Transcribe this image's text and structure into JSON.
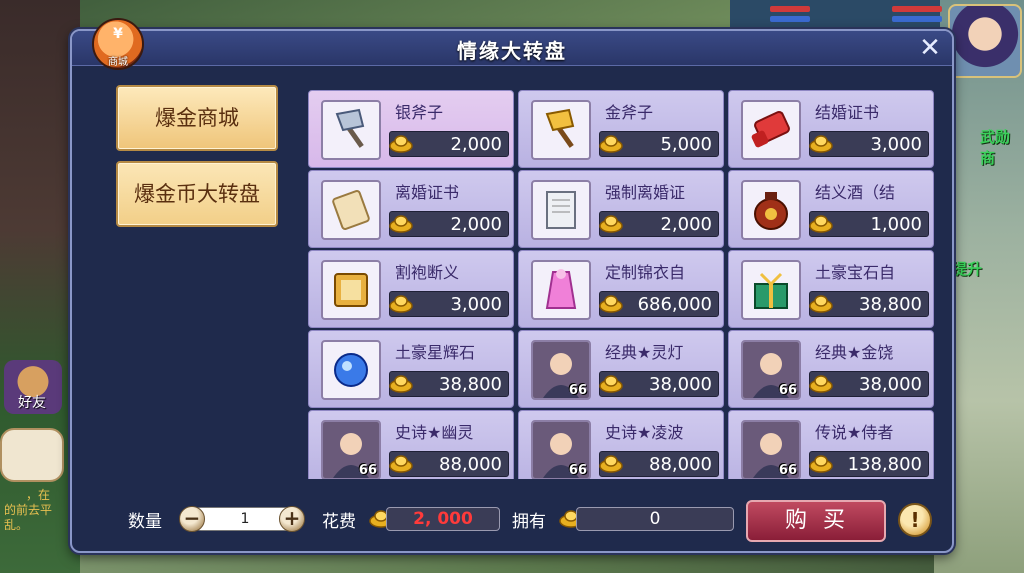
{
  "background": {
    "side_text_1": "武勋商",
    "side_text_2": "提升",
    "friend_label": "好友",
    "chat_text": "的前去平乱。",
    "chat_mid_text": "，在"
  },
  "shop_badge": {
    "symbol": "¥",
    "label": "商城"
  },
  "title": "情缘大转盘",
  "tabs": [
    {
      "label": "爆金商城"
    },
    {
      "label": "爆金币大转盘"
    }
  ],
  "items": [
    {
      "name": "银斧子",
      "price": "2,000",
      "icon": "silver-axe-icon"
    },
    {
      "name": "金斧子",
      "price": "5,000",
      "icon": "gold-axe-icon"
    },
    {
      "name": "结婚证书",
      "price": "3,000",
      "icon": "marriage-scroll-icon"
    },
    {
      "name": "离婚证书",
      "price": "2,000",
      "icon": "divorce-scroll-icon"
    },
    {
      "name": "强制离婚证",
      "price": "2,000",
      "icon": "forced-divorce-paper-icon"
    },
    {
      "name": "结义酒（结",
      "price": "1,000",
      "icon": "wine-jar-icon"
    },
    {
      "name": "割袍断义",
      "price": "3,000",
      "icon": "cut-robe-scroll-icon"
    },
    {
      "name": "定制锦衣自",
      "price": "686,000",
      "icon": "custom-outfit-icon"
    },
    {
      "name": "土豪宝石自",
      "price": "38,800",
      "icon": "gem-gift-box-icon"
    },
    {
      "name": "土豪星辉石",
      "price": "38,800",
      "icon": "blue-star-gem-icon"
    },
    {
      "name": "经典★灵灯",
      "price": "38,000",
      "icon": "hero-portrait-icon",
      "level": "66"
    },
    {
      "name": "经典★金饶",
      "price": "38,000",
      "icon": "hero-portrait-icon",
      "level": "66"
    },
    {
      "name": "史诗★幽灵",
      "price": "88,000",
      "icon": "hero-portrait-icon",
      "level": "66"
    },
    {
      "name": "史诗★凌波",
      "price": "88,000",
      "icon": "hero-portrait-icon",
      "level": "66"
    },
    {
      "name": "传说★侍者",
      "price": "138,800",
      "icon": "hero-portrait-icon",
      "level": "66"
    }
  ],
  "bottom": {
    "quantity_label": "数量",
    "quantity_value": "1",
    "minus": "−",
    "plus": "+",
    "cost_label": "花费",
    "cost_value": "2, 000",
    "owned_label": "拥有",
    "owned_value": "0",
    "buy_label": "购买",
    "info": "!"
  },
  "close": "✕",
  "colors": {
    "panel_bg": "#1f2a4c",
    "item_bg": "#c5bee9",
    "tab_bg": "#f4d592",
    "cost_red": "#ff3a3a",
    "buy_btn": "#a02e48"
  }
}
